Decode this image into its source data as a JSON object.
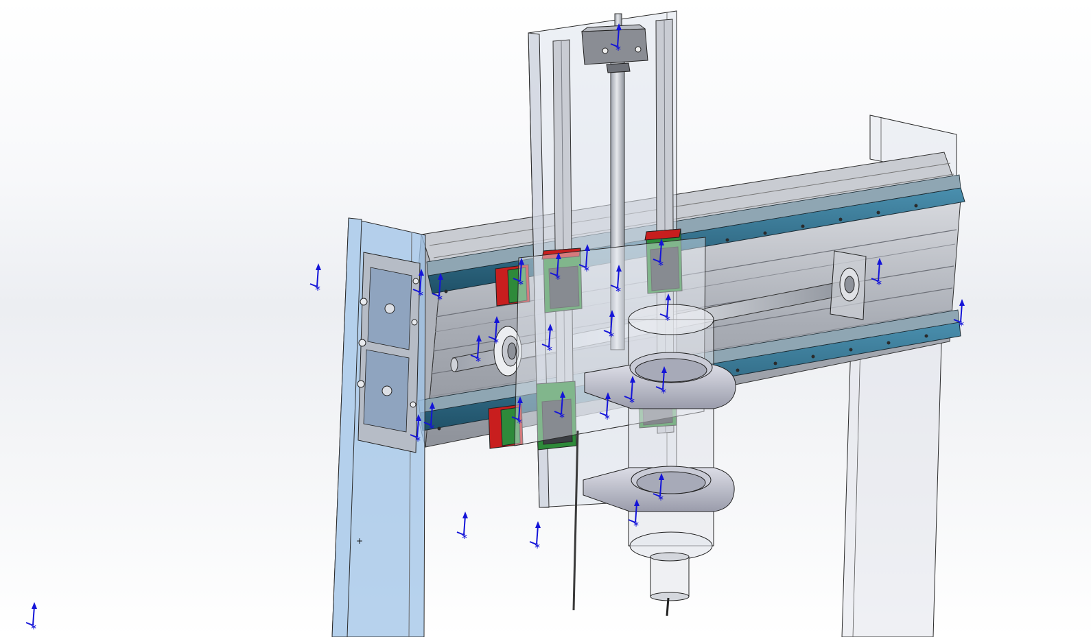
{
  "app": {
    "view": "cad-3d-viewport",
    "theme": {
      "background_top": "#ffffff",
      "background_mid": "#eceef2",
      "selection_blue": "#9fc3e7",
      "triad_color": "#1414d8",
      "aluminum": "#b9bcc3",
      "rail_blue": "#2f6f8a",
      "carriage_red": "#c81e1e",
      "carriage_green": "#2e8a3a",
      "transparent_plate": "#dfe3ec"
    }
  },
  "model": {
    "components": [
      {
        "name": "left-upright",
        "state": "selected"
      },
      {
        "name": "right-upright",
        "state": "transparent"
      },
      {
        "name": "x-axis-extrusion-beam",
        "state": "shaded"
      },
      {
        "name": "linear-rail-top",
        "state": "shaded"
      },
      {
        "name": "linear-rail-bottom",
        "state": "shaded"
      },
      {
        "name": "z-axis-back-plate",
        "state": "transparent"
      },
      {
        "name": "z-axis-front-plate",
        "state": "transparent"
      },
      {
        "name": "z-axis-ballscrew",
        "state": "shaded"
      },
      {
        "name": "z-axis-motor-mount",
        "state": "shaded"
      },
      {
        "name": "x-axis-ballscrew",
        "state": "shaded"
      },
      {
        "name": "ballscrew-nut-flange",
        "state": "shaded"
      },
      {
        "name": "bearing-block-end",
        "state": "transparent"
      },
      {
        "name": "spindle-clamp-upper",
        "state": "shaded"
      },
      {
        "name": "spindle-clamp-lower",
        "state": "shaded"
      },
      {
        "name": "spindle-body",
        "state": "transparent"
      },
      {
        "name": "tool-probe-wire",
        "state": "shaded"
      }
    ],
    "triad_icon": "coordinate-triad-icon",
    "origin_marker": "+"
  }
}
